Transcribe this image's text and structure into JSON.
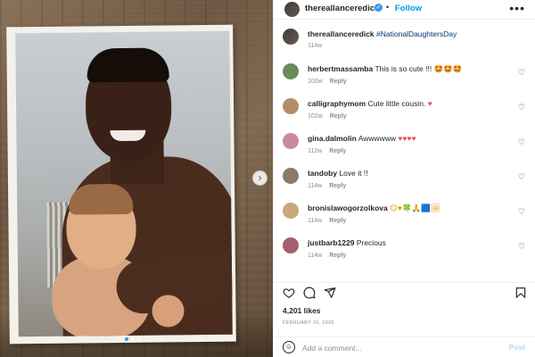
{
  "post": {
    "username": "thereallanceredick",
    "follow_label": "Follow",
    "separator": "•",
    "more_label": "•••",
    "verified_mark": "✓",
    "next_label": "›",
    "slide_count": 3,
    "active_slide": 1
  },
  "caption": {
    "username": "thereallanceredick",
    "text": "#NationalDaughtersDay",
    "time": "114w"
  },
  "comments": [
    {
      "username": "herbertmassamba",
      "text": "This is so cute !!!",
      "emoji": "🤩🤩🤩",
      "emoji_class": "emoji-yel",
      "time": "100w",
      "reply_label": "Reply"
    },
    {
      "username": "calligraphymom",
      "text": "Cute little cousin.",
      "emoji": "♥",
      "emoji_class": "emoji-red",
      "time": "102w",
      "reply_label": "Reply"
    },
    {
      "username": "gina.dalmolin",
      "text": "Awwwwww",
      "emoji": "♥♥♥♥",
      "emoji_class": "emoji-red",
      "time": "112w",
      "reply_label": "Reply"
    },
    {
      "username": "tandoby",
      "text": "Love it !!",
      "emoji": "",
      "emoji_class": "",
      "time": "114w",
      "reply_label": "Reply"
    },
    {
      "username": "bronislawogorzolkova",
      "text": "",
      "emoji": "😊♥🍀🙏🟦🖼",
      "emoji_class": "emoji-yel",
      "time": "114w",
      "reply_label": "Reply"
    },
    {
      "username": "justbarb1229",
      "text": "Precious",
      "emoji": "",
      "emoji_class": "",
      "time": "114w",
      "reply_label": "Reply"
    }
  ],
  "actions": {
    "like_icon": "heart-icon",
    "comment_icon": "comment-icon",
    "share_icon": "share-icon",
    "save_icon": "bookmark-icon"
  },
  "likes_text": "4,201 likes",
  "date_text": "FEBRUARY 26, 2020",
  "add_comment": {
    "placeholder": "Add a comment...",
    "post_label": "Post",
    "emoji_icon": "☺"
  },
  "colors": {
    "link_blue": "#0095f6",
    "muted": "#8e8e8e",
    "text": "#262626"
  }
}
